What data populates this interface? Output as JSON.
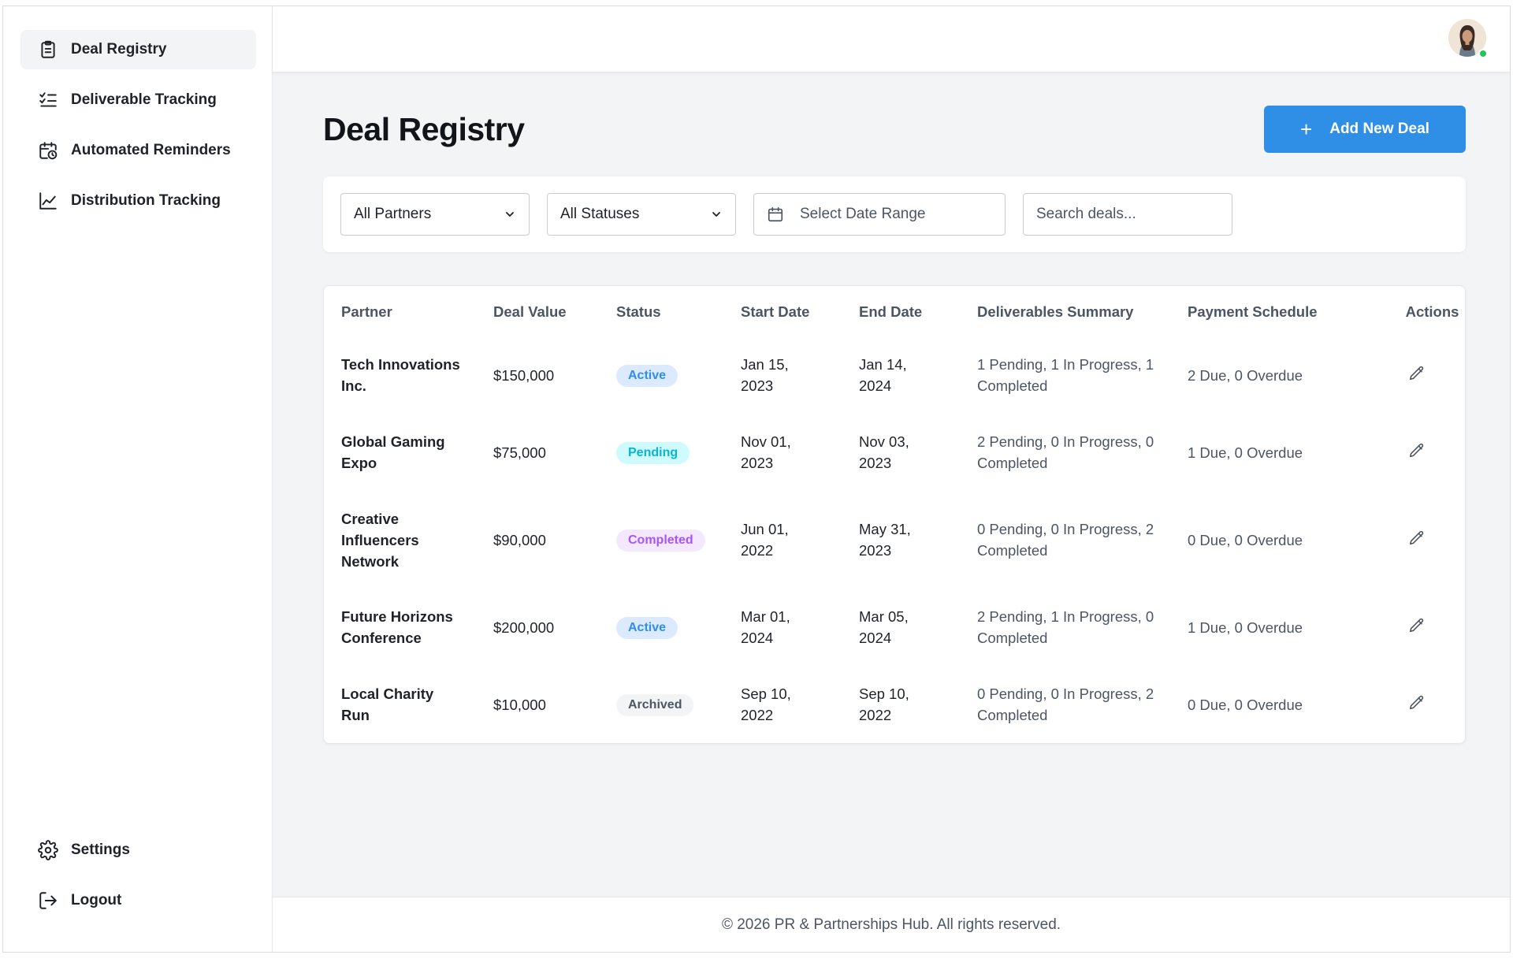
{
  "sidebar": {
    "nav": [
      {
        "label": "Deal Registry",
        "icon": "clipboard-icon",
        "active": true
      },
      {
        "label": "Deliverable Tracking",
        "icon": "checklist-icon",
        "active": false
      },
      {
        "label": "Automated Reminders",
        "icon": "calendar-clock-icon",
        "active": false
      },
      {
        "label": "Distribution Tracking",
        "icon": "line-chart-icon",
        "active": false
      }
    ],
    "bottom": [
      {
        "label": "Settings",
        "icon": "gear-icon"
      },
      {
        "label": "Logout",
        "icon": "logout-icon"
      }
    ]
  },
  "header": {
    "avatar_status_color": "#22c55e"
  },
  "page": {
    "title": "Deal Registry",
    "add_button": "Add New Deal",
    "accent_color": "#2f8fe6"
  },
  "filters": {
    "partners": "All Partners",
    "statuses": "All Statuses",
    "date_range": "Select Date Range",
    "search_placeholder": "Search deals..."
  },
  "table": {
    "headers": [
      "Partner",
      "Deal Value",
      "Status",
      "Start Date",
      "End Date",
      "Deliverables Summary",
      "Payment Schedule",
      "Actions"
    ],
    "rows": [
      {
        "partner": "Tech Innovations Inc.",
        "value": "$150,000",
        "status": "Active",
        "start": "Jan 15, 2023",
        "end": "Jan 14, 2024",
        "deliverables": "1 Pending, 1 In Progress, 1 Completed",
        "payment": "2 Due, 0 Overdue"
      },
      {
        "partner": "Global Gaming Expo",
        "value": "$75,000",
        "status": "Pending",
        "start": "Nov 01, 2023",
        "end": "Nov 03, 2023",
        "deliverables": "2 Pending, 0 In Progress, 0 Completed",
        "payment": "1 Due, 0 Overdue"
      },
      {
        "partner": "Creative Influencers Network",
        "value": "$90,000",
        "status": "Completed",
        "start": "Jun 01, 2022",
        "end": "May 31, 2023",
        "deliverables": "0 Pending, 0 In Progress, 2 Completed",
        "payment": "0 Due, 0 Overdue"
      },
      {
        "partner": "Future Horizons Conference",
        "value": "$200,000",
        "status": "Active",
        "start": "Mar 01, 2024",
        "end": "Mar 05, 2024",
        "deliverables": "2 Pending, 1 In Progress, 0 Completed",
        "payment": "1 Due, 0 Overdue"
      },
      {
        "partner": "Local Charity Run",
        "value": "$10,000",
        "status": "Archived",
        "start": "Sep 10, 2022",
        "end": "Sep 10, 2022",
        "deliverables": "0 Pending, 0 In Progress, 2 Completed",
        "payment": "0 Due, 0 Overdue"
      }
    ],
    "status_colors": {
      "Active": {
        "bg": "#dbeafe",
        "fg": "#2f8fe6"
      },
      "Pending": {
        "bg": "#cffafe",
        "fg": "#06b6d4"
      },
      "Completed": {
        "bg": "#f3e8ff",
        "fg": "#a855f7"
      },
      "Archived": {
        "bg": "#f3f4f6",
        "fg": "#4b5563"
      }
    }
  },
  "footer": {
    "text": "© 2026 PR & Partnerships Hub. All rights reserved."
  }
}
